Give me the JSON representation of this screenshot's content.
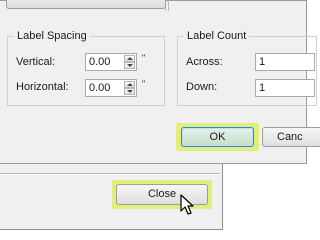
{
  "label_spacing": {
    "title": "Label Spacing",
    "vertical": {
      "label": "Vertical:",
      "value": "0.00",
      "unit": "\""
    },
    "horizontal": {
      "label": "Horizontal:",
      "value": "0.00",
      "unit": "\""
    }
  },
  "label_count": {
    "title": "Label Count",
    "across": {
      "label": "Across:",
      "value": "1"
    },
    "down": {
      "label": "Down:",
      "value": "1"
    }
  },
  "dialog_buttons": {
    "ok": "OK",
    "cancel": "Canc"
  },
  "back_window": {
    "close": "Close"
  },
  "colors": {
    "highlight": "#e3ee7a",
    "focus_border": "#2a8bd6"
  },
  "icons": {
    "cursor": "mouse-pointer-icon",
    "spin_up": "arrow-up-icon",
    "spin_down": "arrow-down-icon"
  }
}
